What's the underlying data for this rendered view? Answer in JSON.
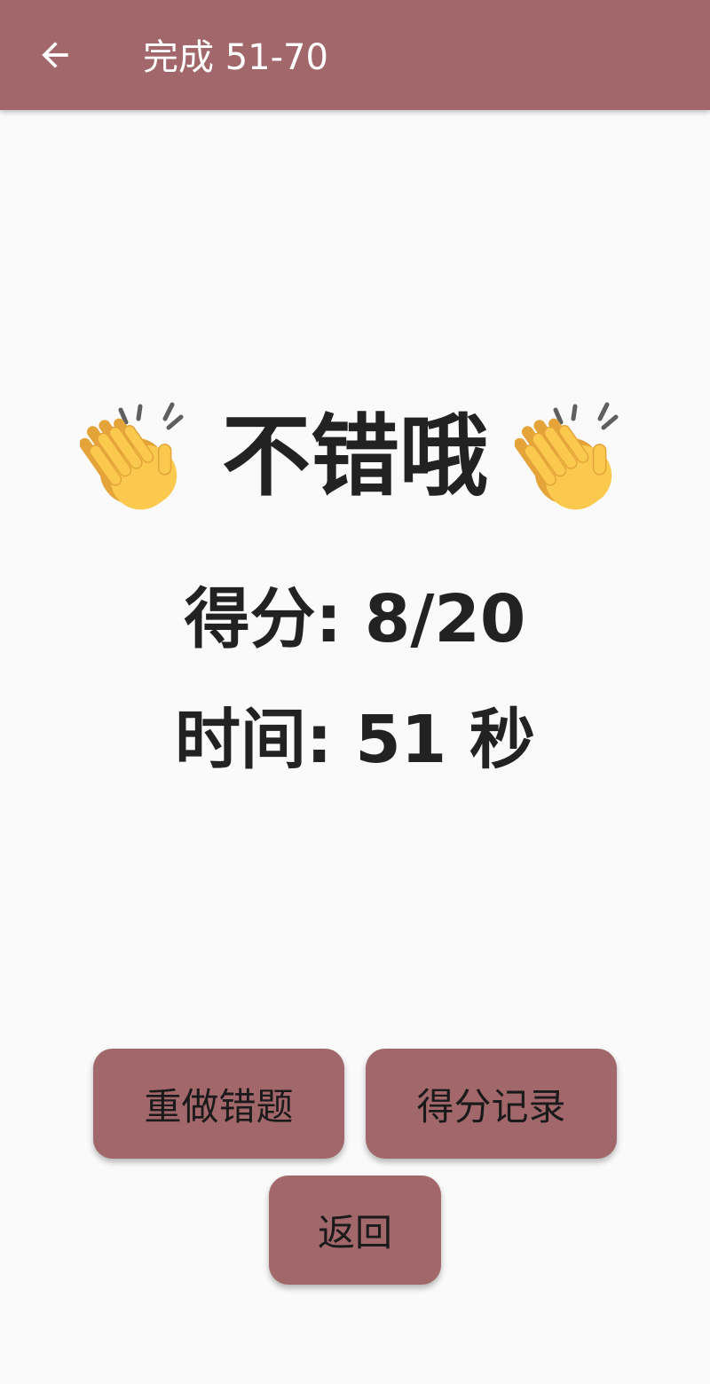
{
  "app_bar": {
    "title": "完成 51-70",
    "background_color": "#a2676a",
    "back_icon": "arrow-left-icon"
  },
  "result": {
    "headline": "不错哦",
    "decoration_icon": "clapping-hands-icon",
    "score_text": "得分: 8/20",
    "time_text": "时间: 51 秒"
  },
  "actions": {
    "redo_wrong_label": "重做错题",
    "score_history_label": "得分记录",
    "back_label": "返回",
    "button_color": "#a2676a"
  }
}
